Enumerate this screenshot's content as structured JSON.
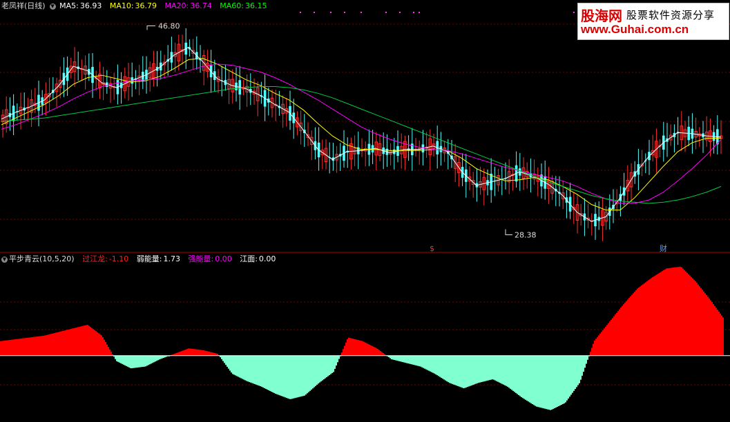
{
  "top_legend": {
    "title": "老凤祥(日线)",
    "items": [
      {
        "label": "MA5:",
        "value": "36.93",
        "color": "#ffffff"
      },
      {
        "label": "MA10:",
        "value": "36.79",
        "color": "#ffff00"
      },
      {
        "label": "MA20:",
        "value": "36.74",
        "color": "#ff00ff"
      },
      {
        "label": "MA60:",
        "value": "36.15",
        "color": "#00ff00"
      }
    ]
  },
  "bottom_legend": {
    "title": "平步青云(10,5,20)",
    "items": [
      {
        "label": "过江龙:",
        "value": "-1.10",
        "color": "#ff2020"
      },
      {
        "label": "弱能量:",
        "value": "1.73",
        "color": "#ffffff"
      },
      {
        "label": "强能量:",
        "value": "0.00",
        "color": "#ff00ff"
      },
      {
        "label": "江面:",
        "value": "0.00",
        "color": "#ffffff"
      }
    ]
  },
  "watermark": {
    "cn": "股海网",
    "cn2": "股票软件资源分享",
    "url": "www.Guhai.com.cn"
  },
  "chart_data": [
    {
      "type": "candlestick",
      "high_label": "46.80",
      "low_label": "28.38",
      "markers": [
        "$",
        "财"
      ],
      "ma_lines": [
        {
          "name": "MA5",
          "color": "#ffffff",
          "values": [
            38.5,
            39.1,
            39.6,
            40.2,
            41.5,
            43.2,
            42.8,
            41.7,
            41.3,
            41.9,
            42.4,
            43.1,
            44.2,
            44.9,
            43.6,
            42.1,
            41.5,
            41.2,
            40.6,
            39.8,
            39.1,
            37.5,
            35.8,
            34.9,
            35.6,
            35.7,
            35.9,
            35.5,
            35.8,
            35.8,
            36.1,
            35.6,
            33.8,
            32.6,
            32.9,
            33.2,
            33.8,
            33.4,
            32.7,
            31.7,
            30.2,
            29.4,
            29.8,
            31.5,
            33.6,
            35.2,
            36.4,
            37.3,
            37.2,
            37.0,
            36.9
          ]
        },
        {
          "name": "MA10",
          "color": "#ffff00",
          "values": [
            38.0,
            38.6,
            39.2,
            39.8,
            40.6,
            41.6,
            42.2,
            42.4,
            42.1,
            41.8,
            41.9,
            42.3,
            43.0,
            43.8,
            43.9,
            43.4,
            42.7,
            42.0,
            41.5,
            40.8,
            40.2,
            39.3,
            38.1,
            37.0,
            36.2,
            35.8,
            35.8,
            35.7,
            35.7,
            35.7,
            35.8,
            35.7,
            35.0,
            34.1,
            33.5,
            33.0,
            33.1,
            33.3,
            33.1,
            32.5,
            31.8,
            30.9,
            30.4,
            30.4,
            31.5,
            32.9,
            34.3,
            35.6,
            36.4,
            36.8,
            36.8
          ]
        },
        {
          "name": "MA20",
          "color": "#ff00ff",
          "values": [
            37.6,
            38.0,
            38.5,
            39.0,
            39.6,
            40.3,
            40.9,
            41.4,
            41.7,
            41.9,
            42.0,
            42.1,
            42.4,
            42.8,
            43.2,
            43.4,
            43.3,
            43.0,
            42.7,
            42.2,
            41.6,
            40.9,
            40.2,
            39.4,
            38.6,
            37.8,
            37.2,
            36.7,
            36.3,
            36.0,
            35.8,
            35.7,
            35.4,
            35.0,
            34.6,
            34.2,
            33.9,
            33.6,
            33.3,
            33.0,
            32.5,
            31.9,
            31.4,
            31.0,
            31.0,
            31.3,
            32.0,
            33.0,
            34.1,
            35.3,
            36.7
          ]
        },
        {
          "name": "MA60",
          "color": "#00cc44",
          "values": [
            38.3,
            38.4,
            38.5,
            38.6,
            38.8,
            39.0,
            39.2,
            39.4,
            39.6,
            39.8,
            40.0,
            40.2,
            40.4,
            40.6,
            40.8,
            41.0,
            41.2,
            41.3,
            41.4,
            41.4,
            41.3,
            41.1,
            40.8,
            40.4,
            39.9,
            39.4,
            38.9,
            38.4,
            37.9,
            37.4,
            36.9,
            36.4,
            35.9,
            35.4,
            34.9,
            34.4,
            33.9,
            33.4,
            32.9,
            32.5,
            32.1,
            31.7,
            31.4,
            31.2,
            31.1,
            31.0,
            31.1,
            31.3,
            31.6,
            32.0,
            32.5
          ]
        }
      ],
      "ylim": [
        27,
        48
      ]
    },
    {
      "type": "area",
      "series": [
        {
          "name": "过江龙",
          "color": "#ff0000",
          "values": [
            1.6,
            1.8,
            2.0,
            2.2,
            2.6,
            3.0,
            3.4,
            2.2,
            -0.6,
            -1.4,
            -1.2,
            -0.4,
            0.2,
            0.8,
            0.6,
            0.2,
            -2.0,
            -2.8,
            -3.4,
            -4.2,
            -4.8,
            -4.4,
            -3.0,
            -1.8,
            2.0,
            1.6,
            0.8,
            -0.4,
            -0.8,
            -1.2,
            -2.0,
            -3.0,
            -3.6,
            -3.0,
            -2.6,
            -3.4,
            -4.6,
            -5.6,
            -6.0,
            -5.2,
            -3.0,
            1.6,
            3.6,
            5.6,
            7.4,
            8.6,
            9.6,
            9.8,
            8.2,
            6.2,
            4.0
          ]
        }
      ],
      "ylim": [
        -7,
        10
      ]
    }
  ]
}
